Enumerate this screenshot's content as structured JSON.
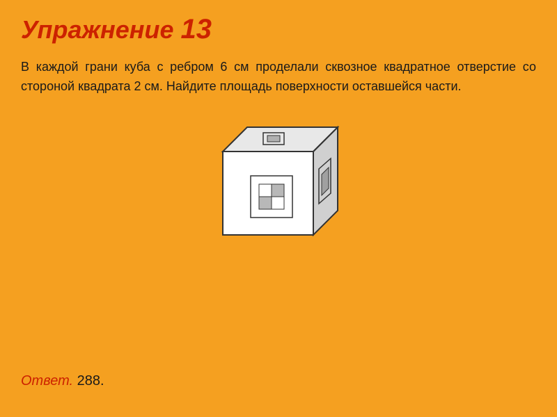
{
  "page": {
    "background_color": "#F5A020",
    "title": {
      "prefix": "Упражнение ",
      "number": "13"
    },
    "problem_text": "В каждой грани куба с ребром 6 см проделали сквозное квадратное отверстие со стороной квадрата 2 см. Найдите площадь поверхности оставшейся части.",
    "answer": {
      "label": "Ответ.",
      "value": " 288."
    }
  }
}
